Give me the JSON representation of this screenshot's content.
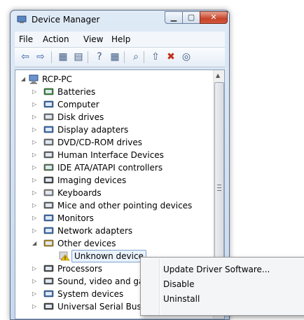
{
  "window": {
    "title": "Device Manager"
  },
  "menu": [
    "File",
    "Action",
    "View",
    "Help"
  ],
  "toolbar": [
    {
      "name": "back-icon",
      "glyph": "⇦"
    },
    {
      "name": "forward-icon",
      "glyph": "⇨"
    },
    {
      "name": "console-tree-icon",
      "glyph": "▦"
    },
    {
      "name": "properties-icon",
      "glyph": "▤"
    },
    {
      "name": "help-icon",
      "glyph": "?"
    },
    {
      "name": "action-pane-icon",
      "glyph": "▦"
    },
    {
      "name": "scan-hardware-icon",
      "glyph": "⌕"
    },
    {
      "name": "update-driver-icon",
      "glyph": "⇧"
    },
    {
      "name": "uninstall-icon",
      "glyph": "✖"
    },
    {
      "name": "disable-icon",
      "glyph": "◎"
    }
  ],
  "tree": {
    "root": "RCP-PC",
    "nodes": [
      {
        "label": "Batteries",
        "icon": "battery-icon",
        "color": "#3a8a3a"
      },
      {
        "label": "Computer",
        "icon": "computer-icon",
        "color": "#3d6fb3"
      },
      {
        "label": "Disk drives",
        "icon": "disk-drive-icon",
        "color": "#7a7a7a"
      },
      {
        "label": "Display adapters",
        "icon": "display-adapter-icon",
        "color": "#3d6fb3"
      },
      {
        "label": "DVD/CD-ROM drives",
        "icon": "dvd-drive-icon",
        "color": "#7a7a7a"
      },
      {
        "label": "Human Interface Devices",
        "icon": "hid-icon",
        "color": "#6a6a6a"
      },
      {
        "label": "IDE ATA/ATAPI controllers",
        "icon": "ide-controller-icon",
        "color": "#5a7f5a"
      },
      {
        "label": "Imaging devices",
        "icon": "camera-icon",
        "color": "#4a4a4a"
      },
      {
        "label": "Keyboards",
        "icon": "keyboard-icon",
        "color": "#8a8a8a"
      },
      {
        "label": "Mice and other pointing devices",
        "icon": "mouse-icon",
        "color": "#6a6a6a"
      },
      {
        "label": "Monitors",
        "icon": "monitor-icon",
        "color": "#3d6fb3"
      },
      {
        "label": "Network adapters",
        "icon": "network-adapter-icon",
        "color": "#3d6fb3"
      },
      {
        "label": "Other devices",
        "icon": "other-devices-icon",
        "color": "#b38f2a"
      }
    ],
    "child": {
      "label": "Unknown device",
      "icon": "unknown-device-warning-icon"
    },
    "nodes_after": [
      {
        "label": "Processors",
        "icon": "processor-icon",
        "color": "#4a4a4a"
      },
      {
        "label": "Sound, video and ga",
        "icon": "speaker-icon",
        "color": "#5a5a5a"
      },
      {
        "label": "System devices",
        "icon": "system-device-icon",
        "color": "#3d6fb3"
      },
      {
        "label": "Universal Serial Bus c",
        "icon": "usb-icon",
        "color": "#4a4a4a"
      }
    ]
  },
  "context_menu": [
    "Update Driver Software...",
    "Disable",
    "Uninstall"
  ]
}
